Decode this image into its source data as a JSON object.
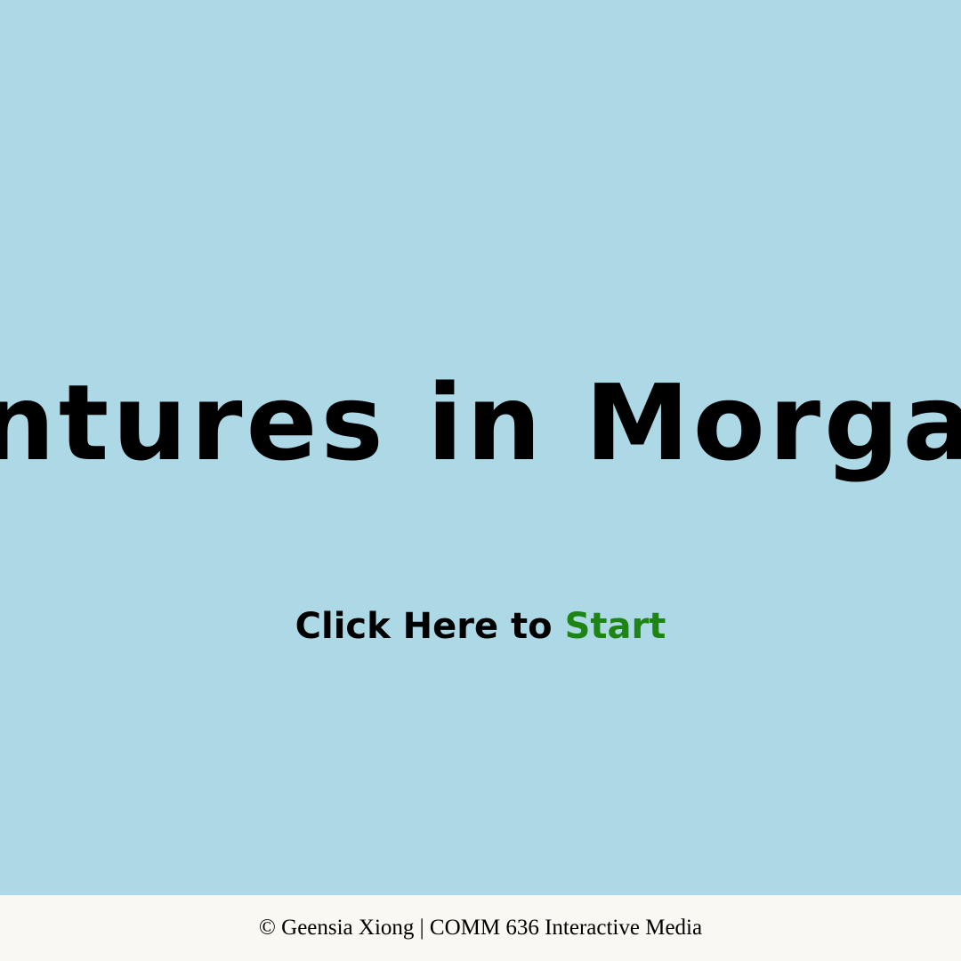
{
  "title_screen": {
    "title": "entures in Morgan",
    "start_prefix": "Click Here to ",
    "start_word": "Start"
  },
  "footer": {
    "copyright": "© Geensia Xiong | COMM 636 Interactive Media"
  },
  "colors": {
    "background": "#ADD8E6",
    "title_text": "#000000",
    "start_accent": "#1E8514",
    "footer_background": "#FAF8F2"
  }
}
